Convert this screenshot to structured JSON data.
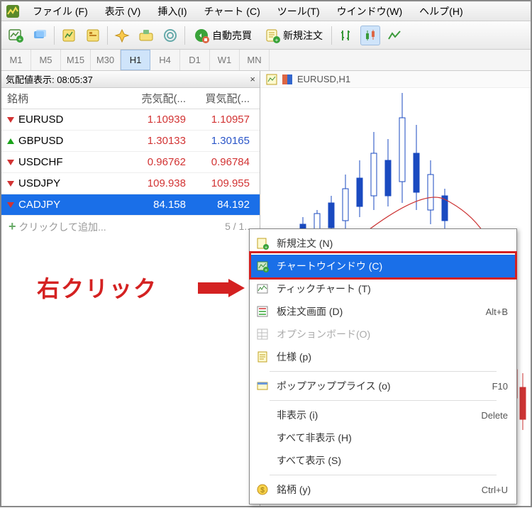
{
  "menu": [
    "ファイル (F)",
    "表示 (V)",
    "挿入(I)",
    "チャート (C)",
    "ツール(T)",
    "ウインドウ(W)",
    "ヘルプ(H)"
  ],
  "toolbar": {
    "autotrade": "自動売買",
    "neworder": "新規注文"
  },
  "timeframes": [
    "M1",
    "M5",
    "M15",
    "M30",
    "H1",
    "H4",
    "D1",
    "W1",
    "MN"
  ],
  "active_tf": "H1",
  "market_watch": {
    "title": "気配値表示: 08:05:37",
    "headers": {
      "symbol": "銘柄",
      "bid": "売気配(...",
      "ask": "買気配(..."
    },
    "rows": [
      {
        "dir": "dn",
        "sym": "EURUSD",
        "bid": "1.10939",
        "ask": "1.10957",
        "bidc": "red",
        "askc": "red"
      },
      {
        "dir": "up",
        "sym": "GBPUSD",
        "bid": "1.30133",
        "ask": "1.30165",
        "bidc": "red",
        "askc": "blue"
      },
      {
        "dir": "dn",
        "sym": "USDCHF",
        "bid": "0.96762",
        "ask": "0.96784",
        "bidc": "red",
        "askc": "red"
      },
      {
        "dir": "dn",
        "sym": "USDJPY",
        "bid": "109.938",
        "ask": "109.955",
        "bidc": "red",
        "askc": "red"
      },
      {
        "dir": "dn",
        "sym": "CADJPY",
        "bid": "84.158",
        "ask": "84.192",
        "bidc": "",
        "askc": "",
        "sel": true
      }
    ],
    "add": "クリックして追加...",
    "count": "5 / 1..."
  },
  "chart": {
    "symbol": "EURUSD,H1"
  },
  "context": [
    {
      "type": "item",
      "icon": "order",
      "label": "新規注文 (N)"
    },
    {
      "type": "item",
      "icon": "chart",
      "label": "チャートウインドウ (C)",
      "sel": true
    },
    {
      "type": "item",
      "icon": "tick",
      "label": "ティックチャート (T)"
    },
    {
      "type": "item",
      "icon": "depth",
      "label": "板注文画面 (D)",
      "shortcut": "Alt+B"
    },
    {
      "type": "item",
      "icon": "opt",
      "label": "オプションボード(O)",
      "grey": true
    },
    {
      "type": "item",
      "icon": "spec",
      "label": "仕様 (p)"
    },
    {
      "type": "sep"
    },
    {
      "type": "item",
      "icon": "popup",
      "label": "ポップアッププライス (o)",
      "shortcut": "F10"
    },
    {
      "type": "sep"
    },
    {
      "type": "item",
      "label": "非表示 (i)",
      "shortcut": "Delete"
    },
    {
      "type": "item",
      "label": "すべて非表示 (H)"
    },
    {
      "type": "item",
      "label": "すべて表示 (S)"
    },
    {
      "type": "sep"
    },
    {
      "type": "item",
      "icon": "symbols",
      "label": "銘柄 (y)",
      "shortcut": "Ctrl+U"
    }
  ],
  "annotation": "右クリック"
}
